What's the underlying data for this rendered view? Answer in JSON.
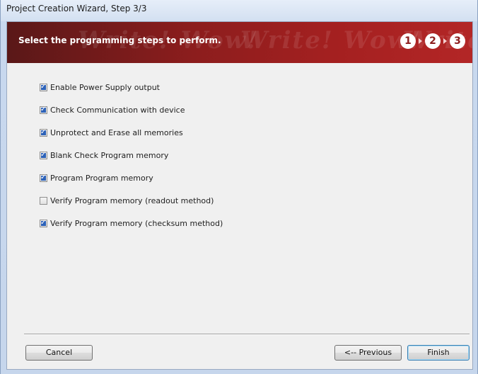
{
  "window": {
    "title": "Project Creation Wizard, Step 3/3"
  },
  "banner": {
    "heading": "Select the programming steps to perform.",
    "watermark_text": "Write! Wow!",
    "steps": [
      "1",
      "2",
      "3"
    ]
  },
  "options": [
    {
      "label": "Enable Power Supply output",
      "checked": true
    },
    {
      "label": "Check Communication with device",
      "checked": true
    },
    {
      "label": "Unprotect and Erase all memories",
      "checked": true
    },
    {
      "label": "Blank Check Program memory",
      "checked": true
    },
    {
      "label": "Program Program memory",
      "checked": true
    },
    {
      "label": "Verify Program memory (readout method)",
      "checked": false
    },
    {
      "label": "Verify Program memory (checksum method)",
      "checked": true
    }
  ],
  "buttons": {
    "cancel": "Cancel",
    "previous": "<-- Previous",
    "finish": "Finish"
  },
  "colors": {
    "banner_dark": "#5a1818",
    "banner_light": "#b32626",
    "check_fill": "#2d62b8"
  }
}
